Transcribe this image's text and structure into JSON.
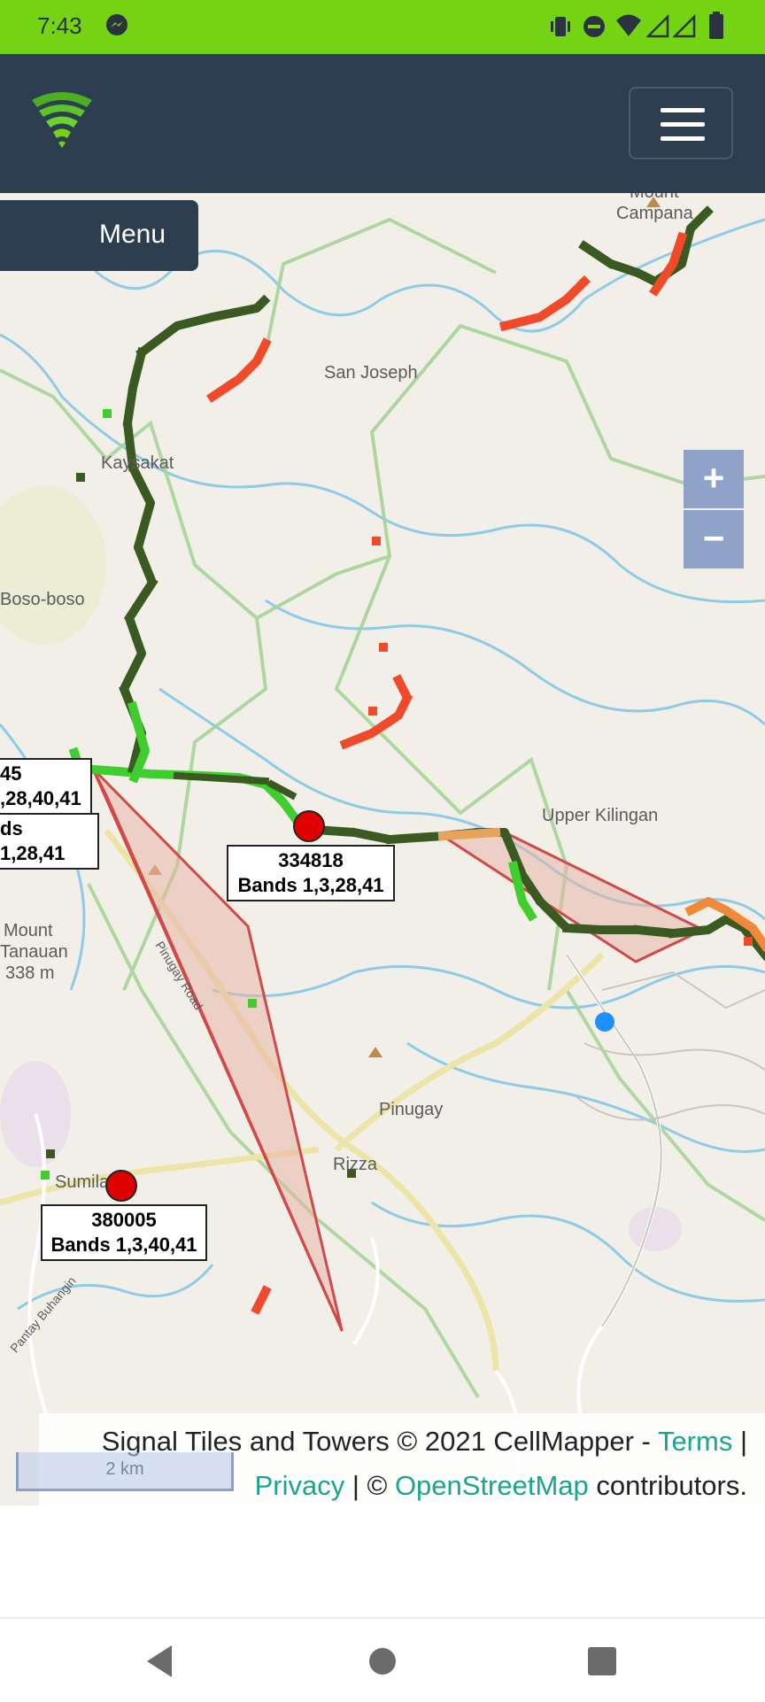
{
  "status_bar": {
    "time": "7:43",
    "icons": [
      "messenger-icon",
      "vibrate-icon",
      "do-not-disturb-icon",
      "wifi-icon",
      "signal-icon",
      "signal-icon",
      "battery-icon"
    ],
    "color": "#74d414"
  },
  "navbar": {
    "logo": "cellmapper-signal-logo",
    "menu_icon": "hamburger-menu-icon",
    "color": "#2c3e50"
  },
  "map": {
    "menu_label": "Menu",
    "zoom_in": "+",
    "zoom_out": "−",
    "place_labels": {
      "mount_campana_1": "Mount",
      "mount_campana_2": "Campana",
      "san_joseph": "San Joseph",
      "kaysakat": "Kaysakat",
      "boso_boso": "Boso-boso",
      "upper_kilingan": "Upper Kilingan",
      "mount_tanauan_1": "Mount",
      "mount_tanauan_2": "Tanauan",
      "mount_tanauan_elev": "338 m",
      "pinugay_road": "Pinugay Road",
      "pinugay": "Pinugay",
      "rizza": "Rizza",
      "sumilang": "Sumilang",
      "pantay_buhangin": "Pantay Buhangin"
    },
    "towers": [
      {
        "id": "334818",
        "bands": "Bands 1,3,28,41"
      },
      {
        "id": "380005",
        "bands": "Bands 1,3,40,41"
      }
    ],
    "cut_labels": [
      {
        "line1": "45",
        "line2": ",28,40,41"
      },
      {
        "line1": "ds 1,28,41"
      }
    ],
    "scale": "2 km",
    "attribution": {
      "prefix": "Signal Tiles and Towers © 2021 CellMapper - ",
      "terms": "Terms",
      "sep1": " |",
      "privacy": "Privacy",
      "sep2": " | © ",
      "osm": "OpenStreetMap",
      "suffix": " contributors."
    },
    "colors": {
      "background": "#f2efe9",
      "river": "#7cc7e8",
      "boundary": "#9bcf8a",
      "road": "#f2eaa0",
      "tower": "#e00000",
      "signal_strong": "#3ecf2e",
      "signal_dark": "#3a5a22",
      "signal_weak": "#f04a2a",
      "sector_fill": "#e8b4a8",
      "sector_line": "#d04a4a",
      "location_dot": "#1e90ff",
      "link": "#1aa58e"
    }
  },
  "nav_bar": {
    "icons": [
      "back-icon",
      "home-icon",
      "recents-icon"
    ]
  }
}
